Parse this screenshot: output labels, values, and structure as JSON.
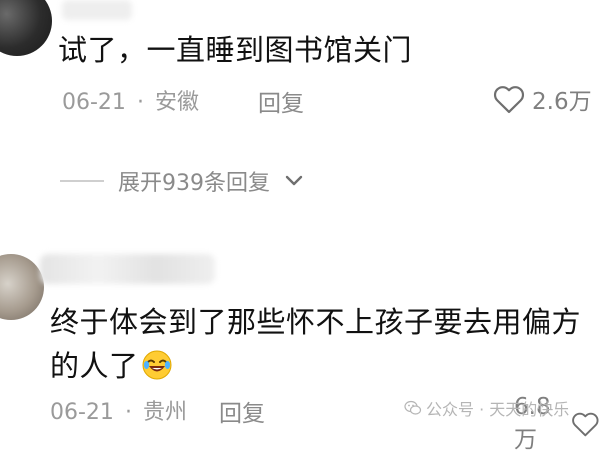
{
  "comments": [
    {
      "text": "试了，一直睡到图书馆关门",
      "date": "06-21",
      "separator": "·",
      "location": "安徽",
      "reply_label": "回复",
      "likes": "2.6万",
      "expand_label": "展开939条回复"
    },
    {
      "text": "终于体会到了那些怀不上孩子要去用偏方的人了",
      "date": "06-21",
      "separator": "·",
      "location": "贵州",
      "reply_label": "回复",
      "likes": "6.8万"
    }
  ],
  "watermark": "公众号 · 天天的快乐",
  "icons": {
    "like": "heart-outline-icon",
    "expand": "chevron-down-icon",
    "emoji": "laughing-crying-emoji",
    "watermark": "wechat-icon"
  }
}
